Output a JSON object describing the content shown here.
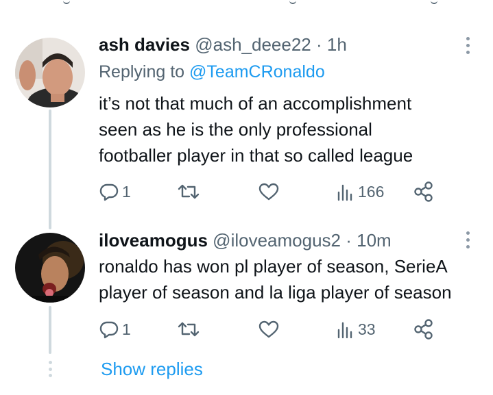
{
  "tweets": [
    {
      "name": "ash davies",
      "handle": "@ash_deee22",
      "separator": "·",
      "time": "1h",
      "replying_prefix": "Replying to",
      "replying_to": "@TeamCRonaldo",
      "lines": [
        "it’s not that much of an accomplishment",
        "seen as he is the only professional",
        "footballer player in that so called league"
      ],
      "reply_count": "1",
      "views": "166"
    },
    {
      "name": "iloveamogus",
      "handle": "@iloveamogus2",
      "separator": "·",
      "time": "10m",
      "lines": [
        "ronaldo has won pl player of season, SerieA",
        "player of season and la liga player of season"
      ],
      "reply_count": "1",
      "views": "33"
    }
  ],
  "show_replies": "Show replies",
  "colors": {
    "accent": "#1d9bf0",
    "secondary_text": "#536471",
    "thread_line": "#cfd9de"
  },
  "icons": [
    "reply-icon",
    "retweet-icon",
    "like-icon",
    "views-icon",
    "share-icon",
    "more-icon"
  ]
}
